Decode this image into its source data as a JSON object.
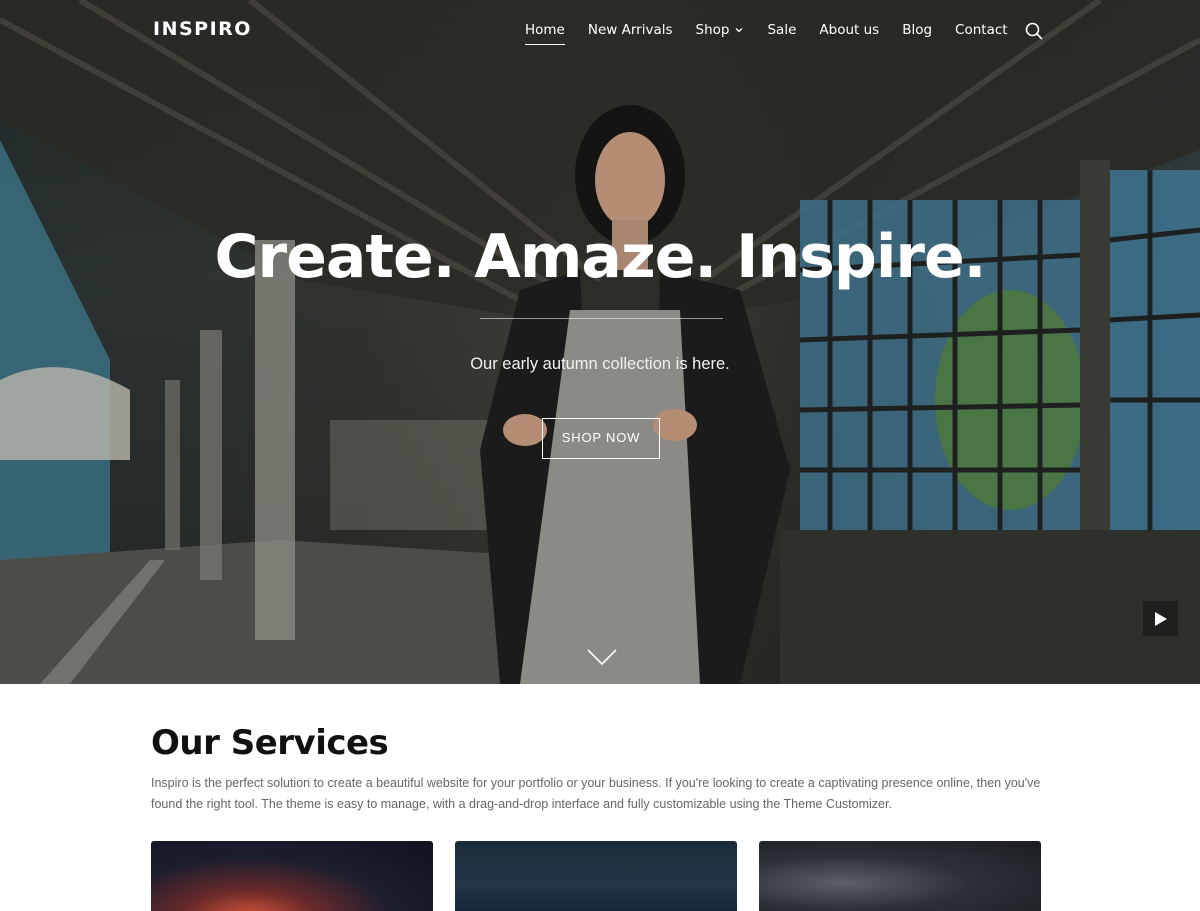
{
  "header": {
    "logo": "INSPIRO",
    "nav": [
      {
        "label": "Home",
        "active": true
      },
      {
        "label": "New Arrivals"
      },
      {
        "label": "Shop",
        "has_dropdown": true
      },
      {
        "label": "Sale"
      },
      {
        "label": "About us"
      },
      {
        "label": "Blog"
      },
      {
        "label": "Contact"
      }
    ],
    "search_icon": "search-icon"
  },
  "hero": {
    "title": "Create. Amaze. Inspire.",
    "subtitle": "Our early autumn collection is here.",
    "cta_label": "SHOP NOW",
    "scroll_icon": "chevron-down-icon",
    "play_icon": "play-icon"
  },
  "services": {
    "title": "Our Services",
    "description": "Inspiro is the perfect solution to create a beautiful website for your portfolio or your business. If you're looking to create a captivating presence online, then you've found the right tool. The theme is easy to manage, with a drag-and-drop interface and fully customizable using the Theme Customizer."
  },
  "colors": {
    "accent": "#ffffff",
    "text_dark": "#111111",
    "text_muted": "#666666"
  }
}
